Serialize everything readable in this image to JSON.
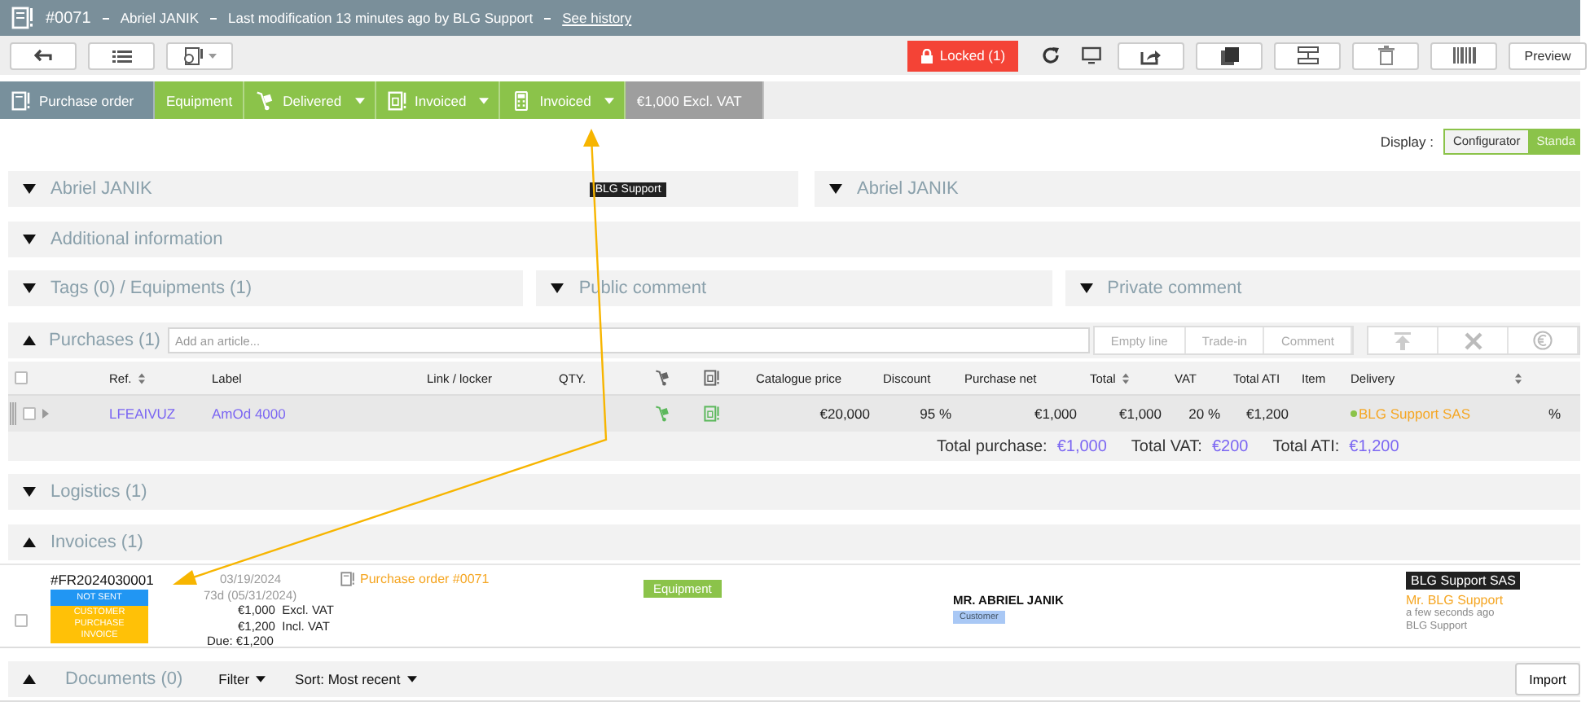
{
  "header": {
    "number": "#0071",
    "customer": "Abriel JANIK",
    "modified": "Last modification 13 minutes ago by BLG Support",
    "history_link": "See history"
  },
  "toolbar": {
    "locked": "Locked (1)",
    "preview": "Preview"
  },
  "status_steps": [
    {
      "kind": "type",
      "label": "Purchase order"
    },
    {
      "kind": "plain",
      "label": "Equipment"
    },
    {
      "kind": "delivery",
      "label": "Delivered"
    },
    {
      "kind": "invoice",
      "label": "Invoiced"
    },
    {
      "kind": "payment",
      "label": "Invoiced"
    },
    {
      "kind": "amount",
      "label": "€1,000 Excl. VAT"
    }
  ],
  "display": {
    "label": "Display :",
    "options": [
      {
        "label": "Configurator",
        "selected": false
      },
      {
        "label": "Standa",
        "selected": true
      }
    ]
  },
  "customer_panels": [
    {
      "title": "Abriel JANIK",
      "badge": "BLG Support",
      "expanded": false
    },
    {
      "title": "Abriel JANIK",
      "expanded": false
    }
  ],
  "additional_info": {
    "title": "Additional information",
    "expanded": false
  },
  "comment_panels": [
    {
      "title": "Tags (0) / Equipments (1)",
      "expanded": false
    },
    {
      "title": "Public comment",
      "expanded": false
    },
    {
      "title": "Private comment",
      "expanded": false
    }
  ],
  "purchases": {
    "title": "Purchases (1)",
    "expanded": true,
    "placeholder": "Add an article...",
    "buttons": [
      "Empty line",
      "Trade-in",
      "Comment"
    ],
    "columns": [
      {
        "kind": "check",
        "checked": false
      },
      {
        "kind": "text",
        "label": "Ref.",
        "sortable": true
      },
      {
        "kind": "text",
        "label": "Label",
        "sortable": false
      },
      {
        "kind": "text",
        "label": "Link / locker",
        "sortable": false
      },
      {
        "kind": "text",
        "label": "QTY.",
        "sortable": false
      },
      {
        "kind": "delivery"
      },
      {
        "kind": "invoice"
      },
      {
        "kind": "text",
        "label": "Catalogue price",
        "sortable": false
      },
      {
        "kind": "text",
        "label": "Discount",
        "sortable": false
      },
      {
        "kind": "text",
        "label": "Purchase net",
        "sortable": false
      },
      {
        "kind": "text",
        "label": "Total",
        "sortable": true
      },
      {
        "kind": "text",
        "label": "VAT",
        "sortable": false
      },
      {
        "kind": "text",
        "label": "Total ATI",
        "sortable": false
      },
      {
        "kind": "text",
        "label": "Item",
        "sortable": false
      },
      {
        "kind": "text",
        "label": "Delivery",
        "sortable": false
      },
      {
        "kind": "sort"
      },
      {
        "kind": "blank"
      }
    ],
    "rows": [
      {
        "checked": false,
        "cells": [
          {
            "kind": "check"
          },
          {
            "kind": "link",
            "text": "LFEAIVUZ"
          },
          {
            "kind": "link",
            "text": "AmOd 4000"
          },
          {
            "kind": "empty"
          },
          {
            "kind": "empty"
          },
          {
            "kind": "delivery"
          },
          {
            "kind": "invoice"
          },
          {
            "kind": "text",
            "text": "€20,000"
          },
          {
            "kind": "text",
            "text": "95 %"
          },
          {
            "kind": "text",
            "text": "€1,000"
          },
          {
            "kind": "text",
            "text": "€1,000"
          },
          {
            "kind": "text",
            "text": "20 %"
          },
          {
            "kind": "text",
            "text": "€1,200"
          },
          {
            "kind": "empty"
          },
          {
            "kind": "status",
            "text": "BLG Support SAS",
            "color": "#8bc34a"
          },
          {
            "kind": "empty"
          },
          {
            "kind": "text",
            "text": "%"
          }
        ]
      }
    ],
    "totals": [
      {
        "label": "Total purchase:",
        "value": "€1,000"
      },
      {
        "label": "Total VAT:",
        "value": "€200"
      },
      {
        "label": "Total ATI:",
        "value": "€1,200"
      }
    ]
  },
  "logistics": {
    "title": "Logistics (1)",
    "expanded": false
  },
  "invoices": {
    "title": "Invoices (1)",
    "expanded": true,
    "items": [
      {
        "checked": false,
        "number": "#FR2024030001",
        "status": "NOT SENT",
        "type": "CUSTOMER PURCHASE INVOICE",
        "date": "03/19/2024",
        "due_in": "73d (05/31/2024)",
        "amounts": [
          "€1,000  Excl. VAT",
          "€1,200  Incl. VAT"
        ],
        "due": "Due: €1,200",
        "source": "Purchase order #0071",
        "tag": "Equipment",
        "contact": "MR. ABRIEL JANIK",
        "contact_role": "Customer",
        "company": "BLG Support SAS",
        "person": "Mr. BLG Support",
        "time": "a few seconds ago",
        "author": "BLG Support"
      }
    ]
  },
  "documents": {
    "title": "Documents (0)",
    "expanded": true,
    "filter": "Filter",
    "sort": "Sort: Most recent",
    "import": "Import"
  }
}
